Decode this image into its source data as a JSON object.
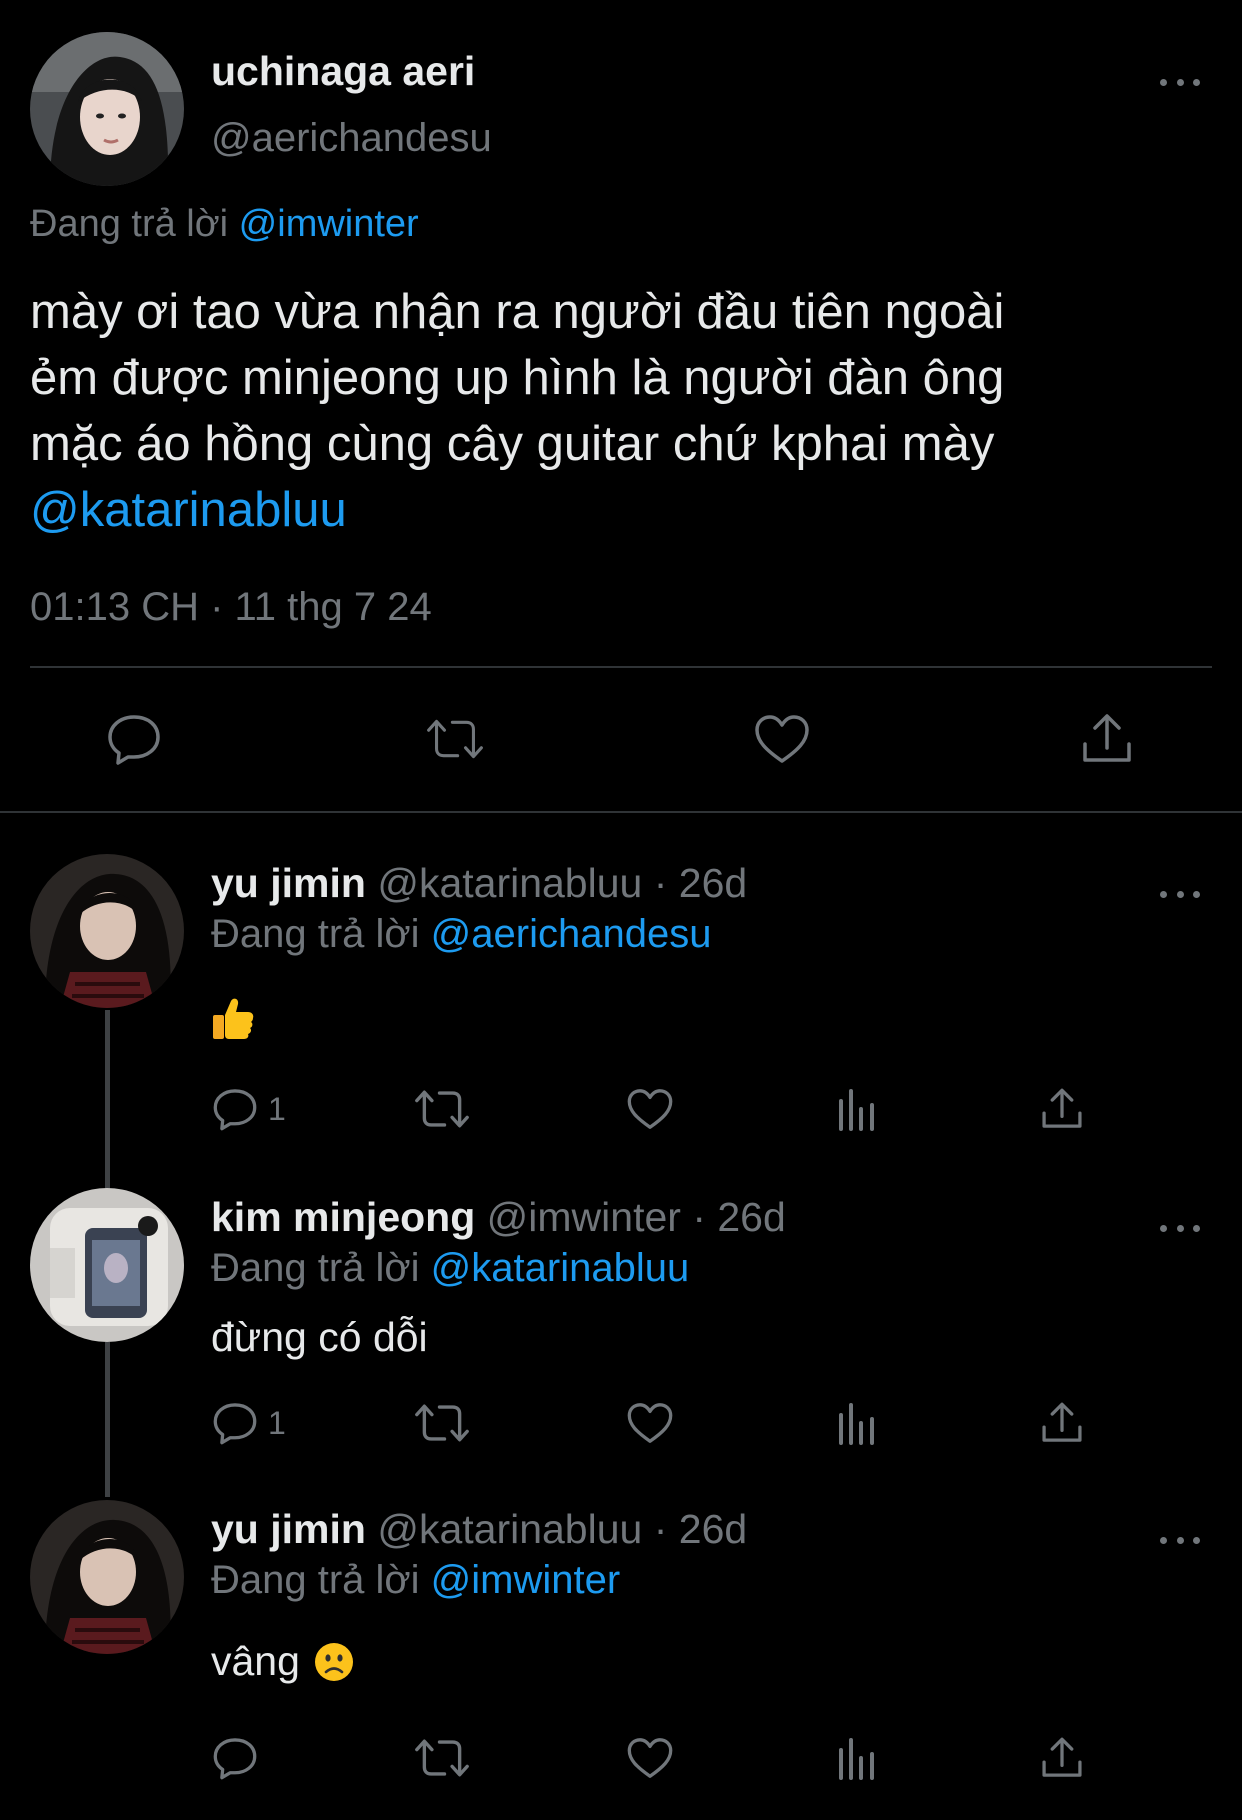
{
  "main_tweet": {
    "display_name": "uchinaga aeri",
    "handle": "@aerichandesu",
    "reply_prefix": "Đang trả lời",
    "reply_to": "@imwinter",
    "text_lines": [
      "mày ơi tao vừa nhận ra người đầu tiên ngoài",
      "ẻm được minjeong up hình là người đàn ông",
      "mặc áo hồng cùng cây guitar chứ kphai mày"
    ],
    "text_mention": "@katarinabluu",
    "timestamp": "01:13 CH · 11 thg 7 24",
    "actions": [
      "reply-icon",
      "retweet-icon",
      "like-icon",
      "share-icon"
    ]
  },
  "replies": [
    {
      "display_name": "yu jimin",
      "meta": "@katarinabluu · 26d",
      "reply_prefix": "Đang trả lời",
      "reply_to": "@aerichandesu",
      "text": "",
      "emoji": "thumbs-up-emoji",
      "reply_count": "1"
    },
    {
      "display_name": "kim minjeong",
      "meta": "@imwinter · 26d",
      "reply_prefix": "Đang trả lời",
      "reply_to": "@katarinabluu",
      "text": "đừng có dỗi",
      "reply_count": "1"
    },
    {
      "display_name": "yu jimin",
      "meta": "@katarinabluu · 26d",
      "reply_prefix": "Đang trả lời",
      "reply_to": "@imwinter",
      "text": "vâng",
      "emoji": "frowning-face-emoji",
      "reply_count": ""
    }
  ],
  "colors": {
    "background": "#000000",
    "primary_text": "#e7e9ea",
    "secondary_text": "#71767b",
    "link": "#1d9bf0",
    "divider": "#2f3336"
  }
}
